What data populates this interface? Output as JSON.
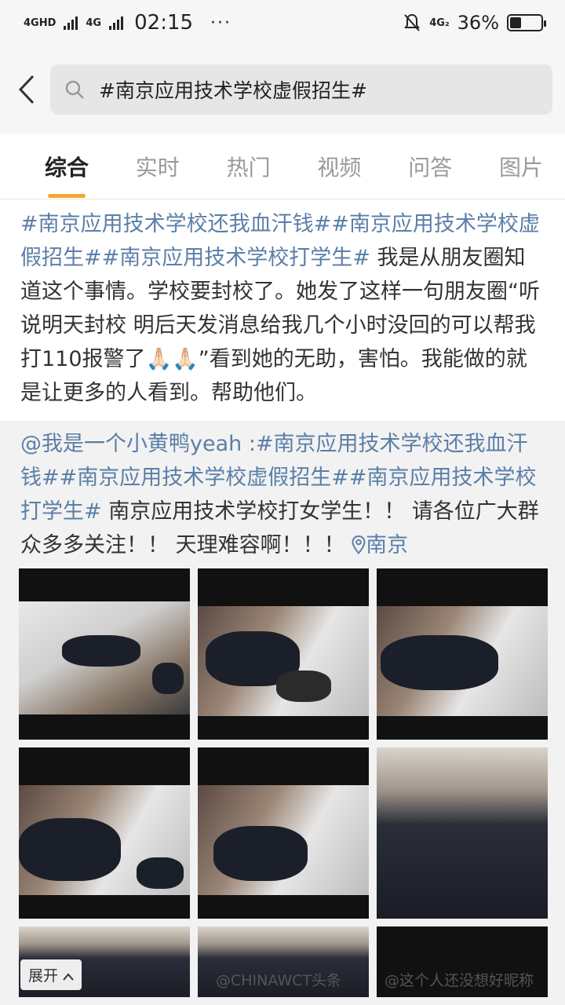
{
  "status": {
    "network1": "4GHD",
    "network2": "4G",
    "time": "02:15",
    "dots": "···",
    "network3": "4G₂",
    "battery": "36%",
    "battery_level": 0.36
  },
  "search": {
    "query": "#南京应用技术学校虚假招生#"
  },
  "tabs": [
    "综合",
    "实时",
    "热门",
    "视频",
    "问答",
    "图片"
  ],
  "post": {
    "tag1": "#南京应用技术学校还我血汗钱#",
    "tag2": "#南京应用技术学校虚假招生#",
    "tag3": "#南京应用技术学校打学生#",
    "text": " 我是从朋友圈知道这个事情。学校要封校了。她发了这样一句朋友圈“听说明天封校  明后天发消息给我几个小时没回的可以帮我打110报警了🙏🏻🙏🏻”看到她的无助，害怕。我能做的就是让更多的人看到。帮助他们。"
  },
  "repost": {
    "user": "@我是一个小黄鸭yeah :",
    "tag1": "#南京应用技术学校还我血汗钱#",
    "tag2": "#南京应用技术学校虚假招生#",
    "tag3": "#南京应用技术学校打学生#",
    "text": " 南京应用技术学校打女学生！！ 请各位广大群众多多关注！！ 天理难容啊！！！ ",
    "location": "南京"
  },
  "expand_label": "展开",
  "watermarks": [
    "@CHINAWCT头条",
    "@这个人还没想好昵称"
  ]
}
